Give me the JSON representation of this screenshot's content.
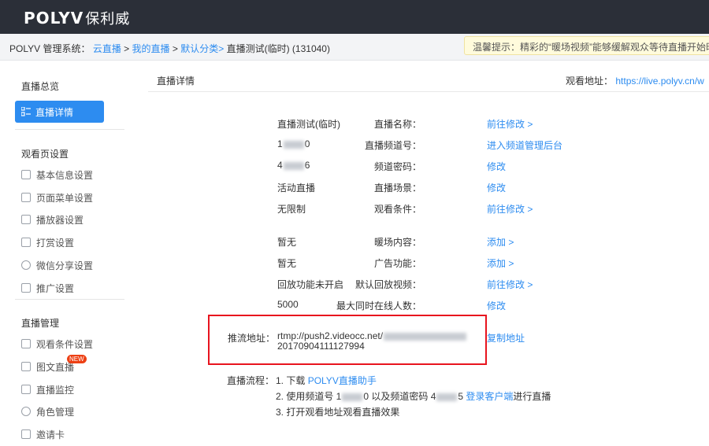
{
  "brand": {
    "name": "POLYV",
    "cn": "保利威"
  },
  "breadcrumb": {
    "system": "POLYV 管理系统：",
    "c1": "云直播",
    "sep": ">",
    "c2": "我的直播",
    "c3": "默认分类>",
    "current": "直播测试(临时) (131040)"
  },
  "notice": "温馨提示：精彩的“暖场视频”能够缓解观众等待直播开始时",
  "sidebar": {
    "overview": "直播总览",
    "active": "直播详情",
    "watch_section": "观看页设置",
    "watch_items": [
      "基本信息设置",
      "页面菜单设置",
      "播放器设置",
      "打赏设置",
      "微信分享设置",
      "推广设置"
    ],
    "manage_section": "直播管理",
    "manage_items": [
      "观看条件设置",
      "图文直播",
      "直播监控",
      "角色管理",
      "邀请卡"
    ],
    "new_badge": "NEW"
  },
  "main": {
    "title": "直播详情",
    "watch_label": "观看地址：",
    "watch_url": "https://live.polyv.cn/w",
    "rows": [
      {
        "label": "直播名称：",
        "value": "直播测试(临时)",
        "action": "前往修改 >"
      },
      {
        "label": "直播频道号：",
        "value_a": "1",
        "value_b": "0",
        "action": "进入频道管理后台"
      },
      {
        "label": "频道密码：",
        "value_a": "4",
        "value_b": "6",
        "action": "修改"
      },
      {
        "label": "直播场景：",
        "value": "活动直播",
        "action": "修改"
      },
      {
        "label": "观看条件：",
        "value": "无限制",
        "action": "前往修改 >"
      },
      {
        "label": "暖场内容：",
        "value": "暂无",
        "action": "添加 >"
      },
      {
        "label": "广告功能：",
        "value": "暂无",
        "action": "添加 >"
      },
      {
        "label": "默认回放视频：",
        "value": "回放功能未开启",
        "action": "前往修改 >"
      },
      {
        "label": "最大同时在线人数：",
        "value": "5000",
        "action": "修改"
      }
    ],
    "push": {
      "label": "推流地址：",
      "url_prefix": "rtmp://push2.videocc.net/",
      "url_suffix": "20170904111127994",
      "action": "复制地址"
    },
    "flow": {
      "label": "直播流程：",
      "step1_text": "1. 下载 ",
      "step1_link": "POLYV直播助手",
      "step2_a": "2. 使用频道号 1",
      "step2_b": "0 以及频道密码 4",
      "step2_c": "5 ",
      "step2_link": "登录客户端",
      "step2_d": "进行直播",
      "step3": "3. 打开观看地址观看直播效果"
    }
  }
}
